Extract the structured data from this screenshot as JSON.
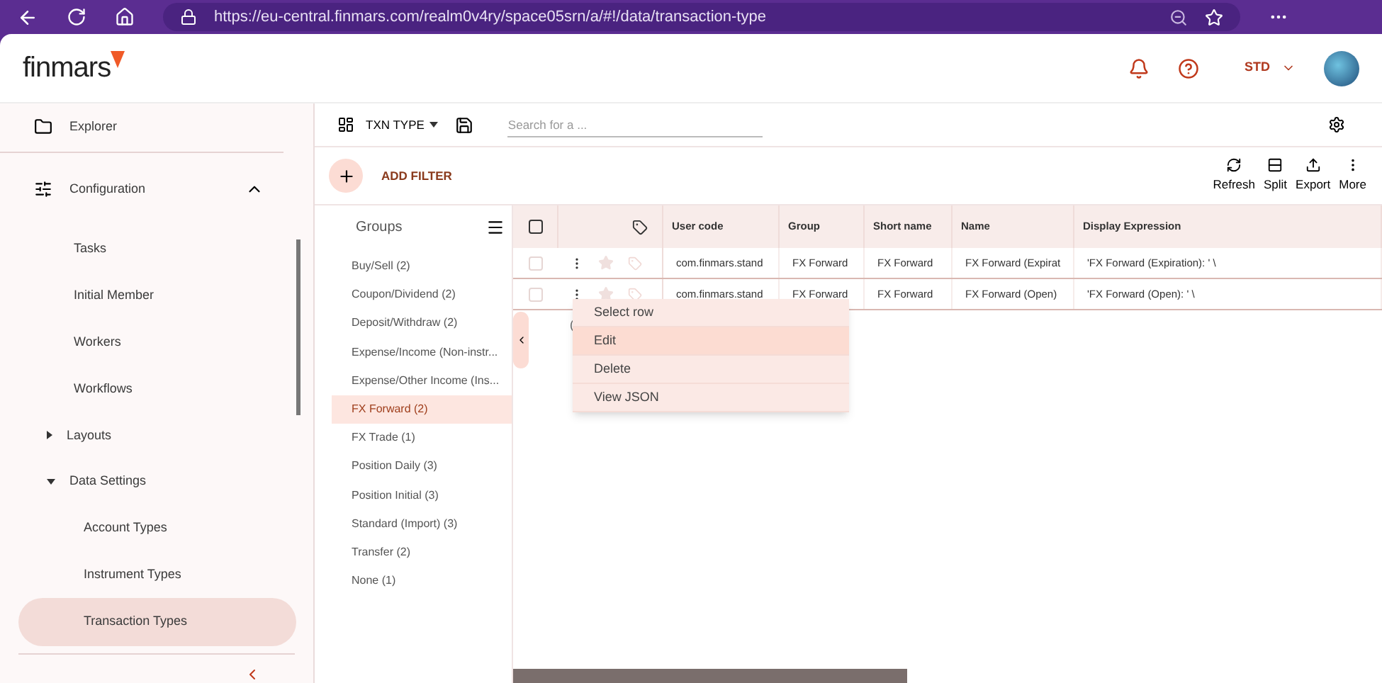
{
  "browser": {
    "url": "https://eu-central.finmars.com/realm0v4ry/space05srn/a/#!/data/transaction-type"
  },
  "header": {
    "logo": "finmars",
    "account": "STD"
  },
  "sidebar": {
    "items": [
      {
        "label": "Explorer",
        "kind": "top",
        "selected": false
      },
      {
        "label": "Configuration",
        "kind": "section",
        "expanded": true,
        "selected": false
      },
      {
        "label": "Tasks",
        "kind": "sub",
        "selected": false
      },
      {
        "label": "Initial Member",
        "kind": "sub",
        "selected": false
      },
      {
        "label": "Workers",
        "kind": "sub",
        "selected": false
      },
      {
        "label": "Workflows",
        "kind": "sub",
        "selected": false
      },
      {
        "label": "Layouts",
        "kind": "folder",
        "expanded": false,
        "selected": false
      },
      {
        "label": "Data Settings",
        "kind": "folder",
        "expanded": true,
        "selected": false
      },
      {
        "label": "Account Types",
        "kind": "leaf",
        "selected": false
      },
      {
        "label": "Instrument Types",
        "kind": "leaf",
        "selected": false
      },
      {
        "label": "Transaction Types",
        "kind": "leaf",
        "selected": true
      }
    ]
  },
  "toolbar": {
    "layout": "TXN TYPE",
    "search": {
      "placeholder": "Search for a ..."
    },
    "add_filter": "ADD FILTER",
    "actions": [
      {
        "label": "Refresh",
        "kind": "refresh"
      },
      {
        "label": "Split",
        "kind": "split"
      },
      {
        "label": "Export",
        "kind": "export"
      },
      {
        "label": "More",
        "kind": "more"
      }
    ]
  },
  "groups": {
    "title": "Groups",
    "items": [
      {
        "label": "Buy/Sell (2)",
        "selected": false
      },
      {
        "label": "Coupon/Dividend (2)",
        "selected": false
      },
      {
        "label": "Deposit/Withdraw (2)",
        "selected": false
      },
      {
        "label": "Expense/Income (Non-instr...",
        "selected": false
      },
      {
        "label": "Expense/Other Income (Ins...",
        "selected": false
      },
      {
        "label": "FX Forward (2)",
        "selected": true
      },
      {
        "label": "FX Trade (1)",
        "selected": false
      },
      {
        "label": "Position Daily (3)",
        "selected": false
      },
      {
        "label": "Position Initial (3)",
        "selected": false
      },
      {
        "label": "Standard (Import) (3)",
        "selected": false
      },
      {
        "label": "Transfer (2)",
        "selected": false
      },
      {
        "label": "None (1)",
        "selected": false
      }
    ]
  },
  "table": {
    "all_checked": false,
    "columns": [
      "User code",
      "Group",
      "Short name",
      "Name",
      "Display Expression"
    ],
    "rows": [
      {
        "checked": false,
        "starred": false,
        "cells": [
          "com.finmars.stand",
          "FX Forward",
          "FX Forward",
          "FX Forward (Expirat",
          "'FX Forward (Expiration): ' \\"
        ]
      },
      {
        "checked": false,
        "starred": false,
        "cells": [
          "com.finmars.stand",
          "FX Forward",
          "FX Forward",
          "FX Forward (Open)",
          "'FX Forward (Open): ' \\"
        ]
      }
    ],
    "footer_fragment": "("
  },
  "context_menu": {
    "items": [
      {
        "label": "Select row",
        "selected": false
      },
      {
        "label": "Edit",
        "selected": true
      },
      {
        "label": "Delete",
        "selected": false
      },
      {
        "label": "View JSON",
        "selected": false
      }
    ]
  }
}
